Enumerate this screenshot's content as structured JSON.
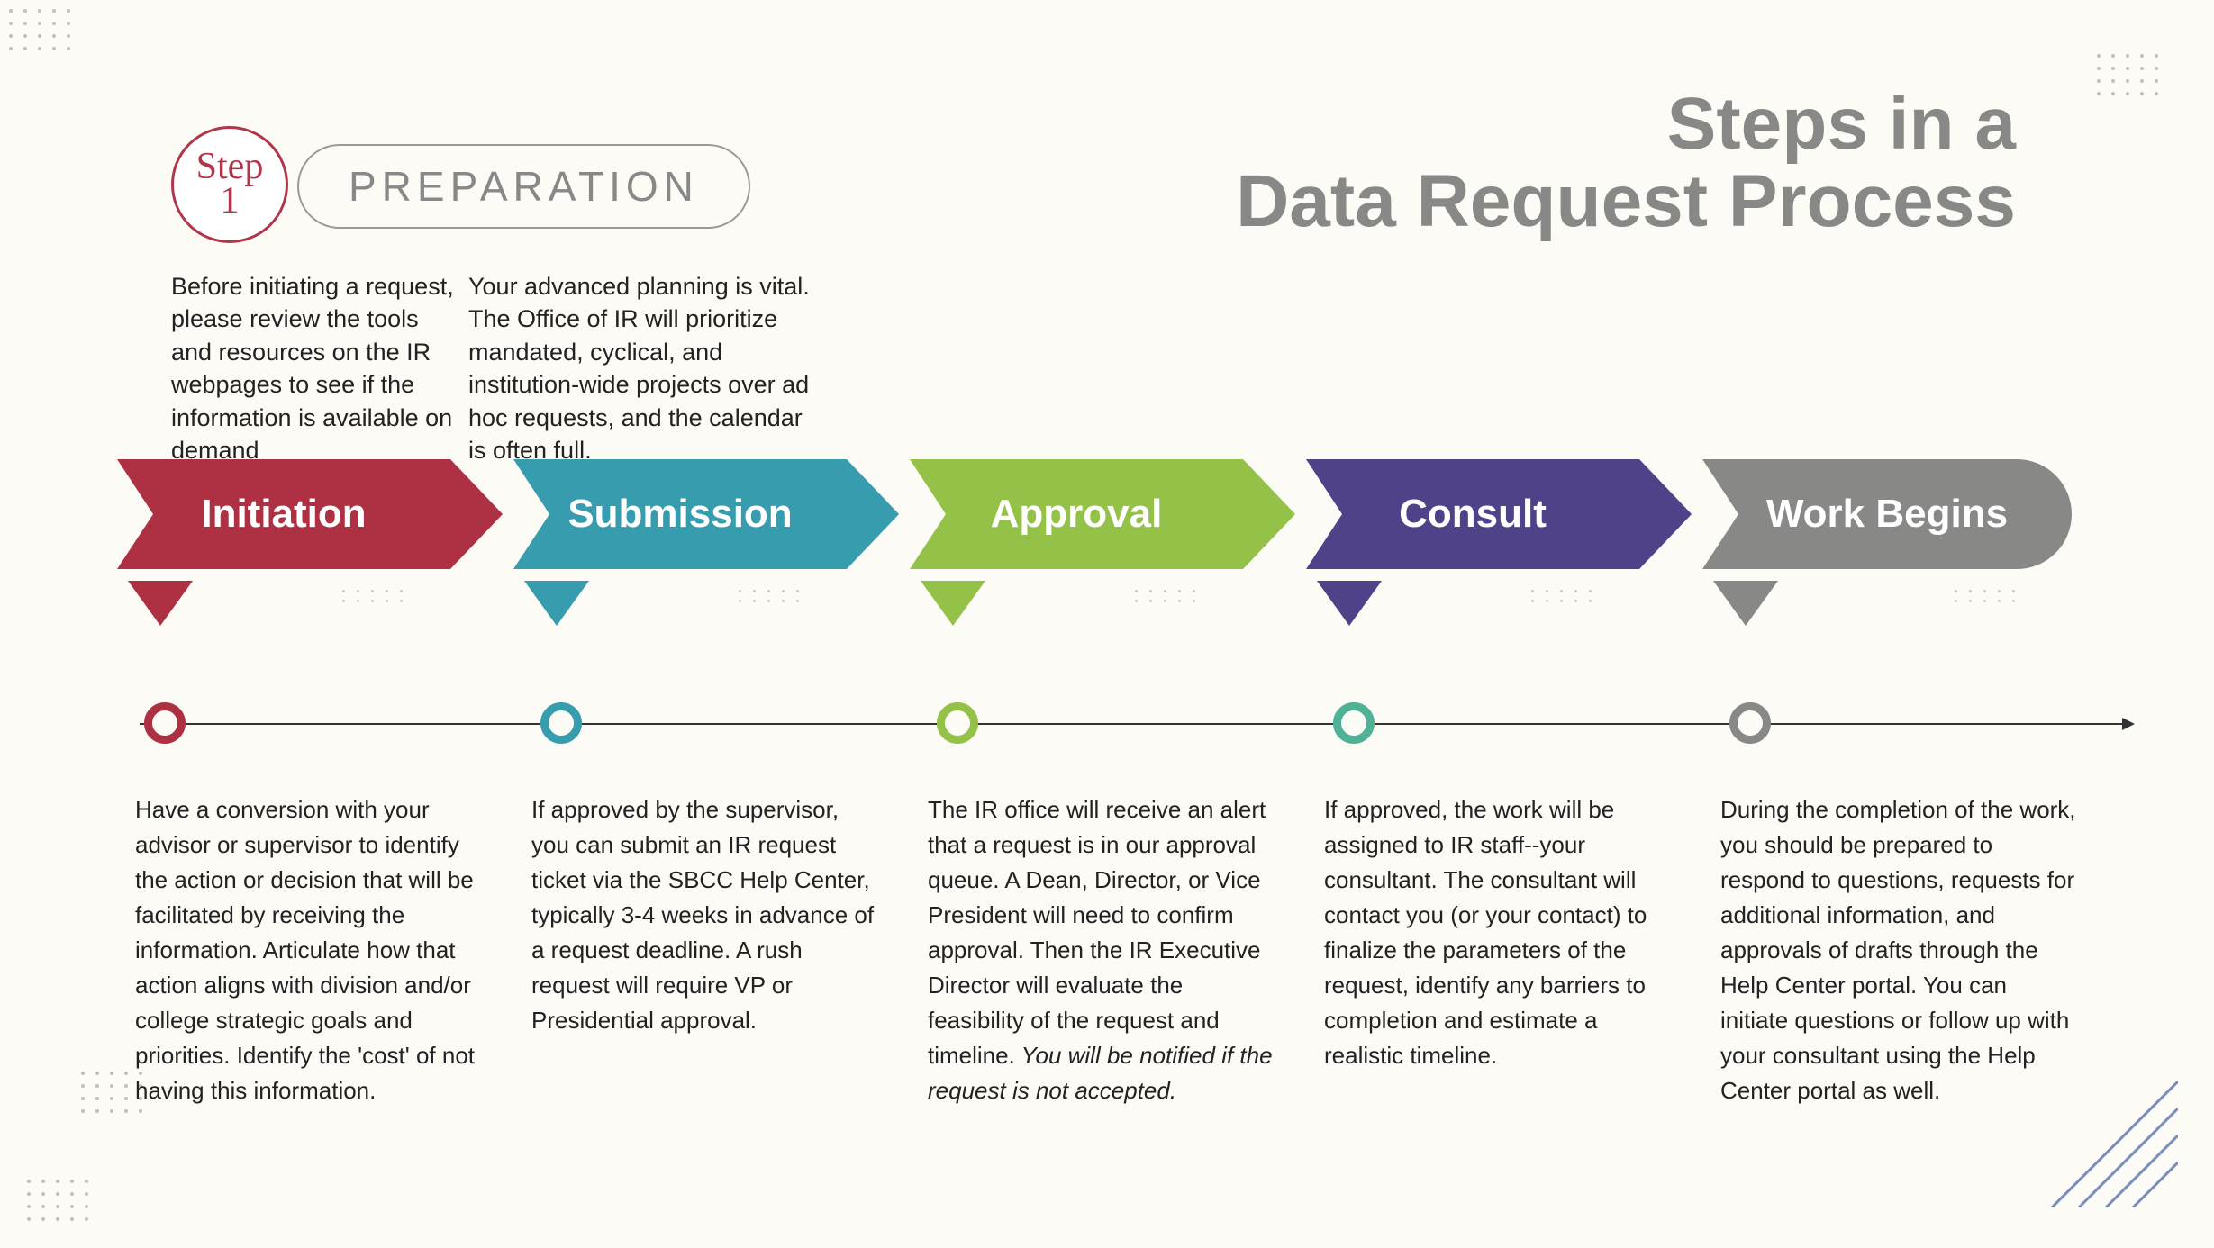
{
  "title_line1": "Steps in a",
  "title_line2": "Data Request Process",
  "step_badge_top": "Step",
  "step_badge_bottom": "1",
  "preparation_label": "PREPARATION",
  "prep_text_a": "Before initiating a request, please review the tools and resources on the IR webpages to see if the information is available on demand",
  "prep_text_b": "Your advanced planning is  vital. The Office of IR will prioritize mandated, cyclical, and institution-wide projects over ad hoc requests, and the calendar is often full.",
  "steps": [
    {
      "label": "Initiation",
      "color": "#ae3043",
      "desc": "Have a conversion with your advisor or supervisor to identify the action or decision that will be facilitated by receiving the information. Articulate how that action aligns with division and/or college strategic goals and priorities. Identify the 'cost' of not having this information."
    },
    {
      "label": "Submission",
      "color": "#369cae",
      "desc": "If approved by the supervisor, you can submit an IR request ticket via the SBCC Help Center, typically 3-4 weeks in advance of a request deadline. A rush request will require VP or Presidential approval."
    },
    {
      "label": "Approval",
      "color": "#94c147",
      "desc": "The IR office will receive an alert that a request is in our approval queue. A Dean, Director, or Vice President will need to confirm approval. Then the IR Executive Director will evaluate the feasibility of the request and timeline.",
      "desc_em": " You will be notified if the request is not accepted."
    },
    {
      "label": "Consult",
      "color": "#4f4289",
      "circle_color": "#4fb196",
      "desc": "If approved, the work will be assigned to IR staff--your consultant. The consultant will contact you (or your contact) to finalize the parameters of the request, identify any barriers to completion and estimate a realistic timeline."
    },
    {
      "label": "Work Begins",
      "color": "#888887",
      "desc": "During the completion of the work, you should be prepared to respond to questions, requests for additional information, and approvals of drafts through the Help Center portal. You can initiate questions or follow up with your consultant using the Help Center portal as well."
    }
  ]
}
